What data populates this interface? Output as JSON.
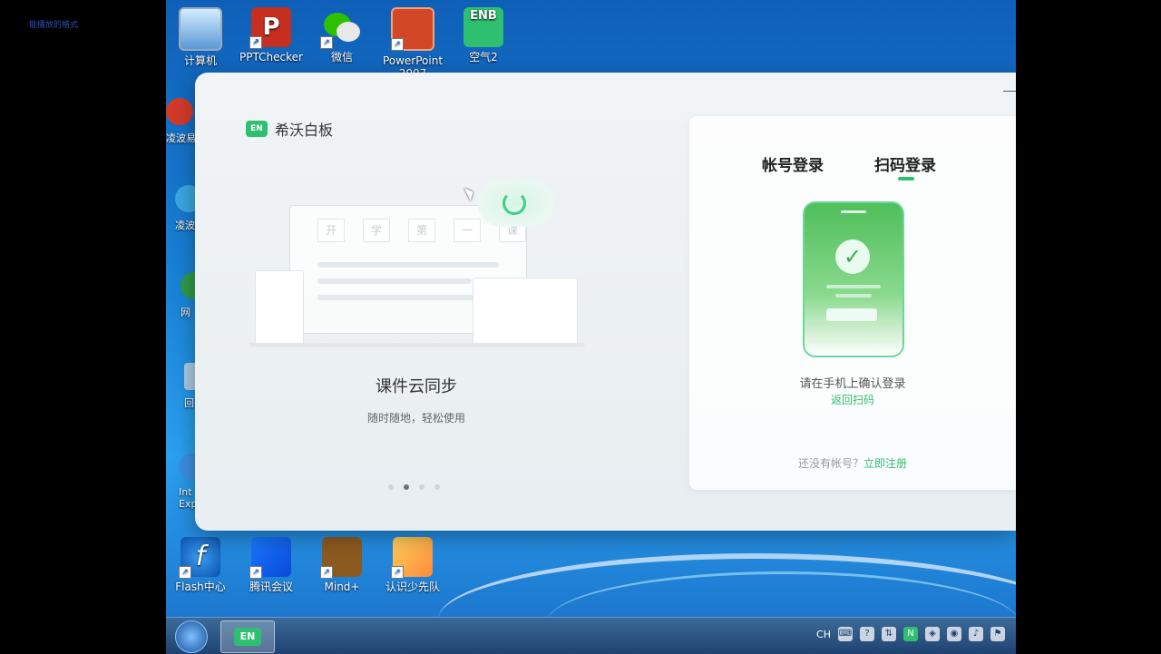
{
  "screen_corner_text": "能播放的格式",
  "desktop": {
    "top_icons": [
      {
        "label": "计算机",
        "icon": "computer-icon"
      },
      {
        "label": "PPTChecker",
        "icon": "ppt-checker-icon",
        "glyph": "P"
      },
      {
        "label": "微信",
        "icon": "wechat-icon"
      },
      {
        "label": "PowerPoint 2007",
        "icon": "powerpoint-icon"
      },
      {
        "label": "空气2",
        "icon": "enb-icon",
        "glyph": "ENB"
      }
    ],
    "left_partial_icons": [
      {
        "label": "凌波易"
      },
      {
        "label": "凌波"
      },
      {
        "label": "网"
      },
      {
        "label": "回"
      },
      {
        "label": "Int Exp"
      }
    ],
    "bottom_icons": [
      {
        "label": "Flash中心",
        "icon": "flash-icon",
        "glyph": "f"
      },
      {
        "label": "腾讯会议",
        "icon": "tencent-meeting-icon"
      },
      {
        "label": "Mind+",
        "icon": "mind-plus-icon"
      },
      {
        "label": "认识少先队",
        "icon": "young-pioneers-icon"
      }
    ]
  },
  "taskbar": {
    "app_label": "EN",
    "tray": {
      "lang": "CH",
      "items": [
        "keyboard-icon",
        "help-icon",
        "network-icon",
        "n-app-icon",
        "shield-icon",
        "security-icon",
        "volume-icon",
        "flag-icon"
      ]
    }
  },
  "app": {
    "brand_logo": "EN",
    "brand_name": "希沃白板",
    "carousel": {
      "board_words": [
        "开",
        "学",
        "第",
        "一",
        "课"
      ],
      "title": "课件云同步",
      "subtitle": "随时随地，轻松使用",
      "dots": 4,
      "active_dot": 1
    },
    "login": {
      "tabs": [
        {
          "label": "帐号登录",
          "active": false
        },
        {
          "label": "扫码登录",
          "active": true
        }
      ],
      "confirm_text": "请在手机上确认登录",
      "back_link": "返回扫码",
      "register_prefix": "还没有帐号？",
      "register_link": "立即注册"
    }
  }
}
